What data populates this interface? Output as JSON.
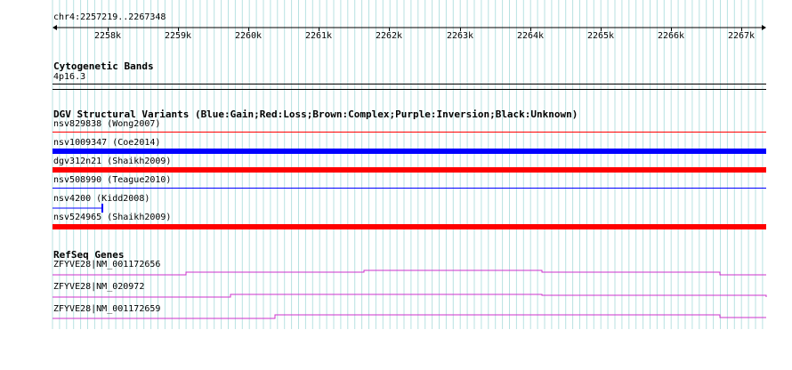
{
  "ruler": {
    "region": "chr4:2257219..2267348",
    "ticks": [
      "2258k",
      "2259k",
      "2260k",
      "2261k",
      "2262k",
      "2263k",
      "2264k",
      "2265k",
      "2266k",
      "2267k"
    ]
  },
  "tracks": {
    "cyto": {
      "title": "Cytogenetic Bands",
      "band": "4p16.3"
    },
    "dgv": {
      "title": "DGV Structural Variants (Blue:Gain;Red:Loss;Brown:Complex;Purple:Inversion;Black:Unknown)",
      "colors": {
        "gain": "#0000ff",
        "loss": "#ff0000"
      },
      "items": [
        {
          "label": "nsv829838 (Wong2007)",
          "type": "loss"
        },
        {
          "label": "nsv1009347 (Coe2014)",
          "type": "gain"
        },
        {
          "label": "dgv312n21 (Shaikh2009)",
          "type": "loss"
        },
        {
          "label": "nsv508990 (Teague2010)",
          "type": "gain"
        },
        {
          "label": "nsv4200 (Kidd2008)",
          "type": "gain"
        },
        {
          "label": "nsv524965 (Shaikh2009)",
          "type": "loss"
        }
      ]
    },
    "refseq": {
      "title": "RefSeq Genes",
      "color": "#cc33cc",
      "items": [
        {
          "label": "ZFYVE28|NM_001172656"
        },
        {
          "label": "ZFYVE28|NM_020972"
        },
        {
          "label": "ZFYVE28|NM_001172659"
        }
      ]
    }
  }
}
